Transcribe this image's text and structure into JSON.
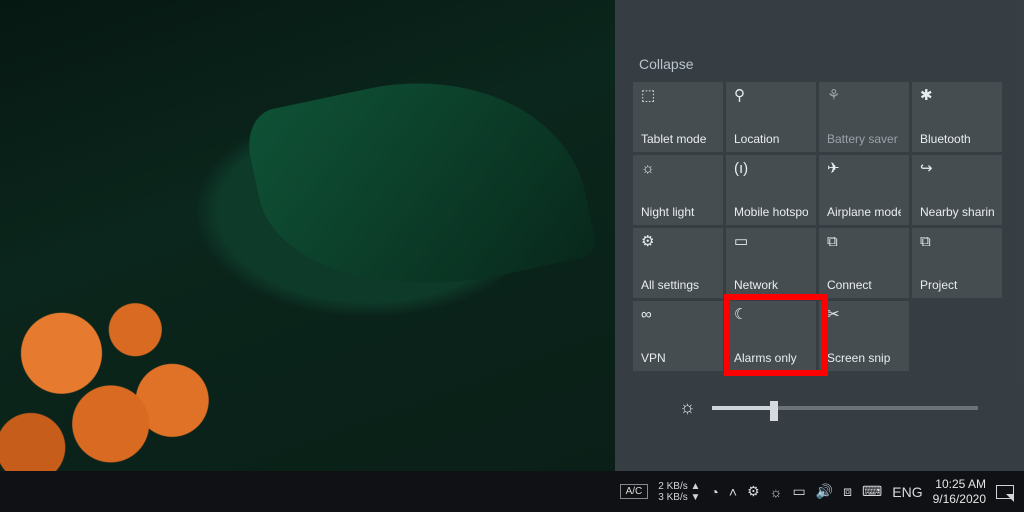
{
  "action_center": {
    "collapse_label": "Collapse",
    "tiles": [
      {
        "id": "tablet-mode",
        "label": "Tablet mode",
        "icon": "tablet-icon",
        "disabled": false
      },
      {
        "id": "location",
        "label": "Location",
        "icon": "location-icon",
        "disabled": false
      },
      {
        "id": "battery-saver",
        "label": "Battery saver",
        "icon": "leaf-icon",
        "disabled": true
      },
      {
        "id": "bluetooth",
        "label": "Bluetooth",
        "icon": "bluetooth-icon",
        "disabled": false
      },
      {
        "id": "night-light",
        "label": "Night light",
        "icon": "sun-icon",
        "disabled": false
      },
      {
        "id": "mobile-hotspot",
        "label": "Mobile hotspot",
        "icon": "hotspot-icon",
        "disabled": false
      },
      {
        "id": "airplane-mode",
        "label": "Airplane mode",
        "icon": "airplane-icon",
        "disabled": false
      },
      {
        "id": "nearby-sharing",
        "label": "Nearby sharing",
        "icon": "share-icon",
        "disabled": false
      },
      {
        "id": "all-settings",
        "label": "All settings",
        "icon": "gear-icon",
        "disabled": false
      },
      {
        "id": "network",
        "label": "Network",
        "icon": "network-icon",
        "disabled": false
      },
      {
        "id": "connect",
        "label": "Connect",
        "icon": "connect-icon",
        "disabled": false
      },
      {
        "id": "project",
        "label": "Project",
        "icon": "project-icon",
        "disabled": false
      },
      {
        "id": "vpn",
        "label": "VPN",
        "icon": "vpn-icon",
        "disabled": false
      },
      {
        "id": "focus-assist",
        "label": "Alarms only",
        "icon": "moon-icon",
        "disabled": false,
        "highlighted": true
      },
      {
        "id": "screen-snip",
        "label": "Screen snip",
        "icon": "snip-icon",
        "disabled": false
      }
    ],
    "brightness_percent": 22
  },
  "taskbar": {
    "ac_indicator": "A/C",
    "net_up": "2 KB/s ▲",
    "net_down": "3 KB/s ▼",
    "lang": "ENG",
    "time": "10:25 AM",
    "date": "9/16/2020"
  },
  "icons": {
    "tablet-icon": "⬚",
    "location-icon": "⚲",
    "leaf-icon": "⚘",
    "bluetooth-icon": "✱",
    "sun-icon": "☼",
    "hotspot-icon": "(ı)",
    "airplane-icon": "✈",
    "share-icon": "↪",
    "gear-icon": "⚙",
    "network-icon": "▭",
    "connect-icon": "⧉",
    "project-icon": "⧉",
    "vpn-icon": "∞",
    "moon-icon": "☾",
    "snip-icon": "✂"
  }
}
